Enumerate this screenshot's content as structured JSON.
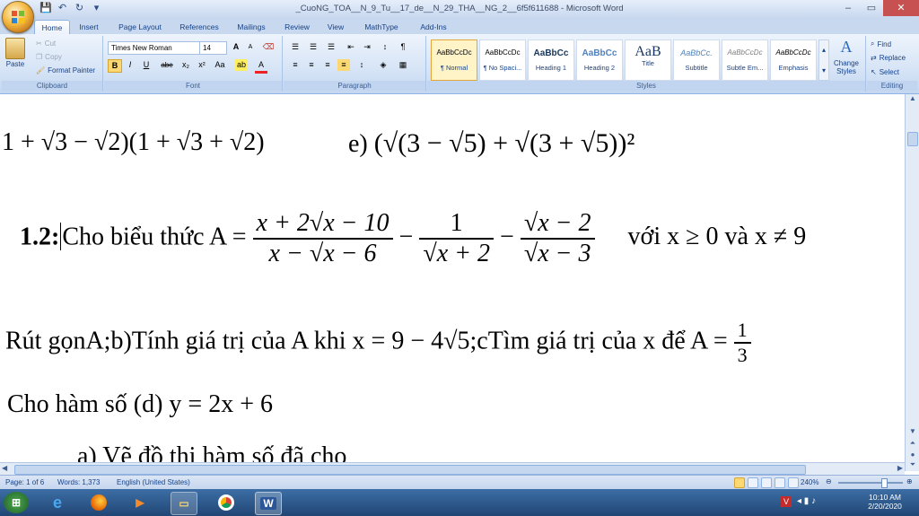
{
  "window": {
    "title": "_CuoNG_TOA__N_9_Tu__17_de__N_29_THA__NG_2__6f5f611688 - Microsoft Word",
    "minimize": "–",
    "maximize": "▭",
    "close": "✕"
  },
  "tabs": [
    "Home",
    "Insert",
    "Page Layout",
    "References",
    "Mailings",
    "Review",
    "View",
    "MathType",
    "Add-Ins"
  ],
  "clipboard": {
    "paste": "Paste",
    "cut": "Cut",
    "copy": "Copy",
    "format_painter": "Format Painter",
    "label": "Clipboard"
  },
  "font": {
    "family": "Times New Roman",
    "size": "14",
    "label": "Font",
    "bold": "B",
    "italic": "I",
    "underline": "U",
    "strike": "abe",
    "sub": "x₂",
    "sup": "x²",
    "case": "Aa",
    "grow": "A",
    "shrink": "A"
  },
  "paragraph": {
    "label": "Paragraph"
  },
  "styles": {
    "label": "Styles",
    "items": [
      {
        "preview": "AaBbCcDc",
        "name": "¶ Normal"
      },
      {
        "preview": "AaBbCcDc",
        "name": "¶ No Spaci..."
      },
      {
        "preview": "AaBbCc",
        "name": "Heading 1"
      },
      {
        "preview": "AaBbCc",
        "name": "Heading 2"
      },
      {
        "preview": "AaB",
        "name": "Title"
      },
      {
        "preview": "AaBbCc.",
        "name": "Subtitle"
      },
      {
        "preview": "AaBbCcDc",
        "name": "Subtle Em..."
      },
      {
        "preview": "AaBbCcDc",
        "name": "Emphasis"
      }
    ],
    "change_styles": "Change Styles"
  },
  "editing": {
    "label": "Editing",
    "find": "Find",
    "replace": "Replace",
    "select": "Select"
  },
  "document": {
    "line1_a": "1 + √3 − √2)(1 + √3 + √2)",
    "line1_e_label": "e)",
    "line2_label": "1.2:",
    "line2_text": "Cho biểu thức A =",
    "f1_num": "x + 2√x − 10",
    "f1_den": "x − √x − 6",
    "f2_num": "1",
    "f2_den": "√x + 2",
    "f3_num": "√x − 2",
    "f3_den": "√x − 3",
    "cond": "với  x ≥ 0 và x ≠ 9",
    "line3": "Rút gọnA;b)Tính giá trị của A khi x =",
    "line3_val": "9 − 4√5",
    "line3_c": ";cTìm giá trị của x để A =",
    "frac_third_num": "1",
    "frac_third_den": "3",
    "line4": "Cho hàm số (d)  y  = 2x + 6",
    "line5": "a)  Vẽ đồ thị hàm số đã cho"
  },
  "status": {
    "page": "Page: 1 of 6",
    "words": "Words: 1,373",
    "language": "English (United States)",
    "zoom": "240%"
  },
  "taskbar": {
    "time": "10:10 AM",
    "date": "2/20/2020"
  }
}
